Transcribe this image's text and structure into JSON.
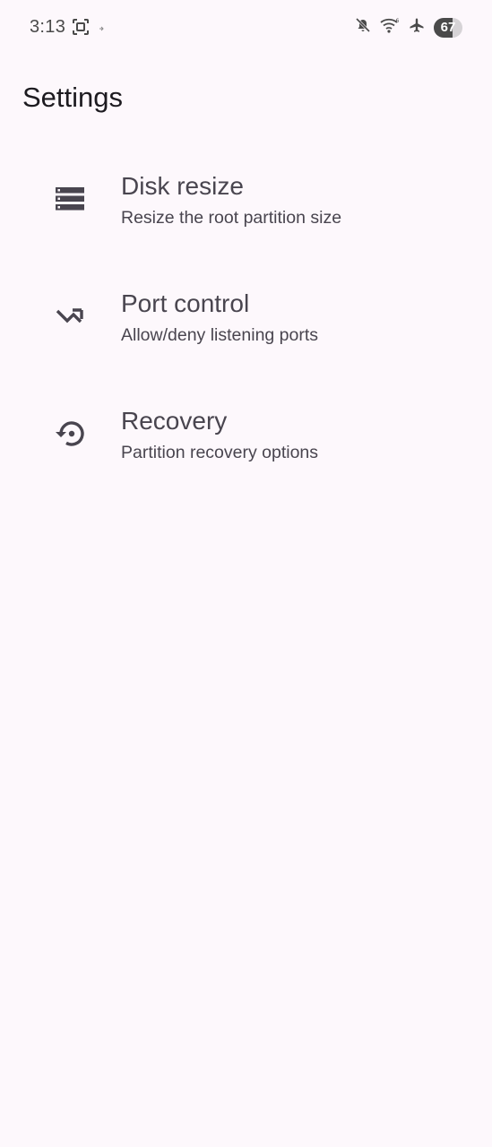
{
  "status_bar": {
    "time": "3:13",
    "battery_level": "67",
    "battery_fraction": 0.67,
    "left_icons": [
      "screen-record-icon",
      "small-notification-icon"
    ],
    "right_icons": [
      "mute-icon",
      "wifi-icon",
      "airplane-icon",
      "battery-icon"
    ]
  },
  "header": {
    "title": "Settings"
  },
  "settings": {
    "items": [
      {
        "title": "Disk resize",
        "subtitle": "Resize the root partition size",
        "icon": "disk-icon"
      },
      {
        "title": "Port control",
        "subtitle": "Allow/deny listening ports",
        "icon": "port-arrow-icon"
      },
      {
        "title": "Recovery",
        "subtitle": "Partition recovery options",
        "icon": "recovery-icon"
      }
    ]
  },
  "colors": {
    "background": "#fdf8fc",
    "text_primary": "#1d1b20",
    "text_secondary": "#49454f",
    "icon": "#49454f"
  }
}
